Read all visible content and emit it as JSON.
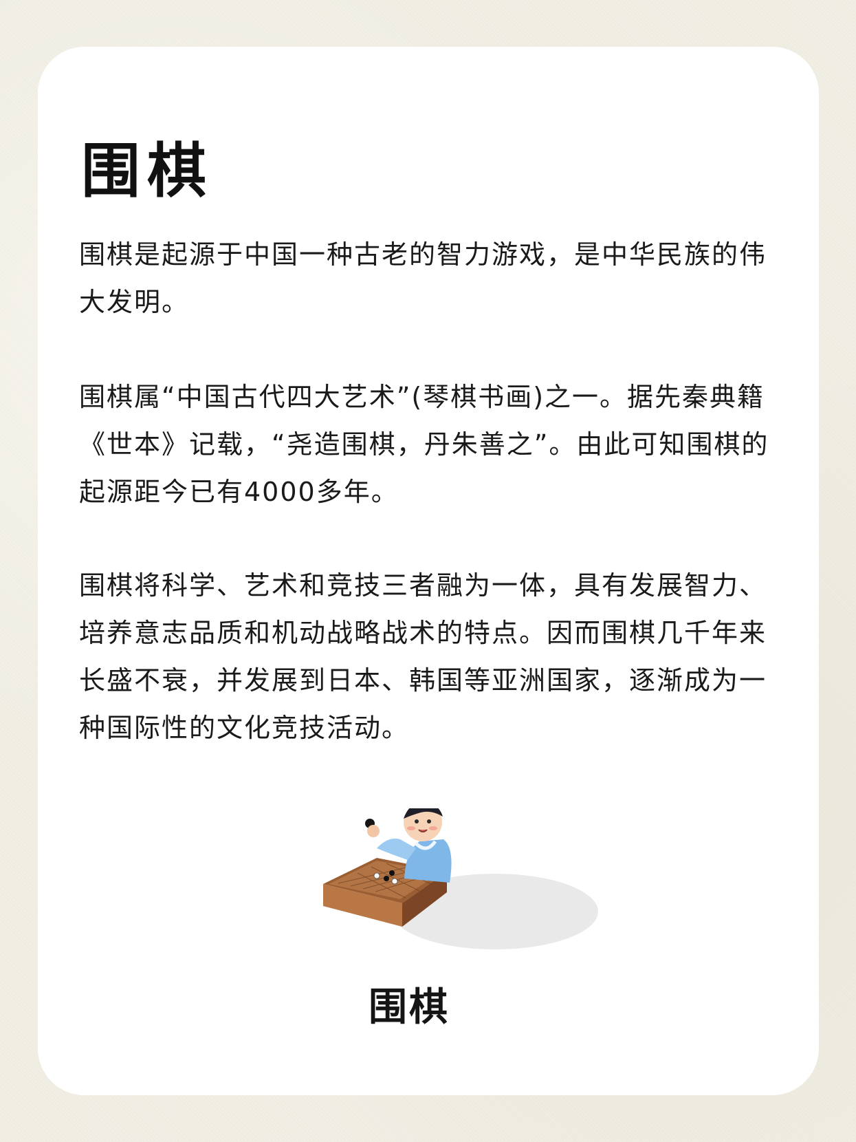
{
  "title": "围棋",
  "paragraphs": [
    "围棋是起源于中国一种古老的智力游戏，是中华民族的伟大发明。",
    "围棋属“中国古代四大艺术”(琴棋书画)之一。据先秦典籍《世本》记载，“尧造围棋，丹朱善之”。由此可知围棋的起源距今已有4000多年。",
    "围棋将科学、艺术和竞技三者融为一体，具有发展智力、培养意志品质和机动战略战术的特点。因而围棋几千年来长盛不衰，并发展到日本、韩国等亚洲国家，逐渐成为一种国际性的文化竞技活动。"
  ],
  "illustration": {
    "caption": "围棋",
    "icon": "go-player-illustration"
  },
  "colors": {
    "background": "#f1efe4",
    "card": "#ffffff",
    "text": "#1a1a1a",
    "robe": "#7fb7e8",
    "board": "#a86a3c"
  }
}
